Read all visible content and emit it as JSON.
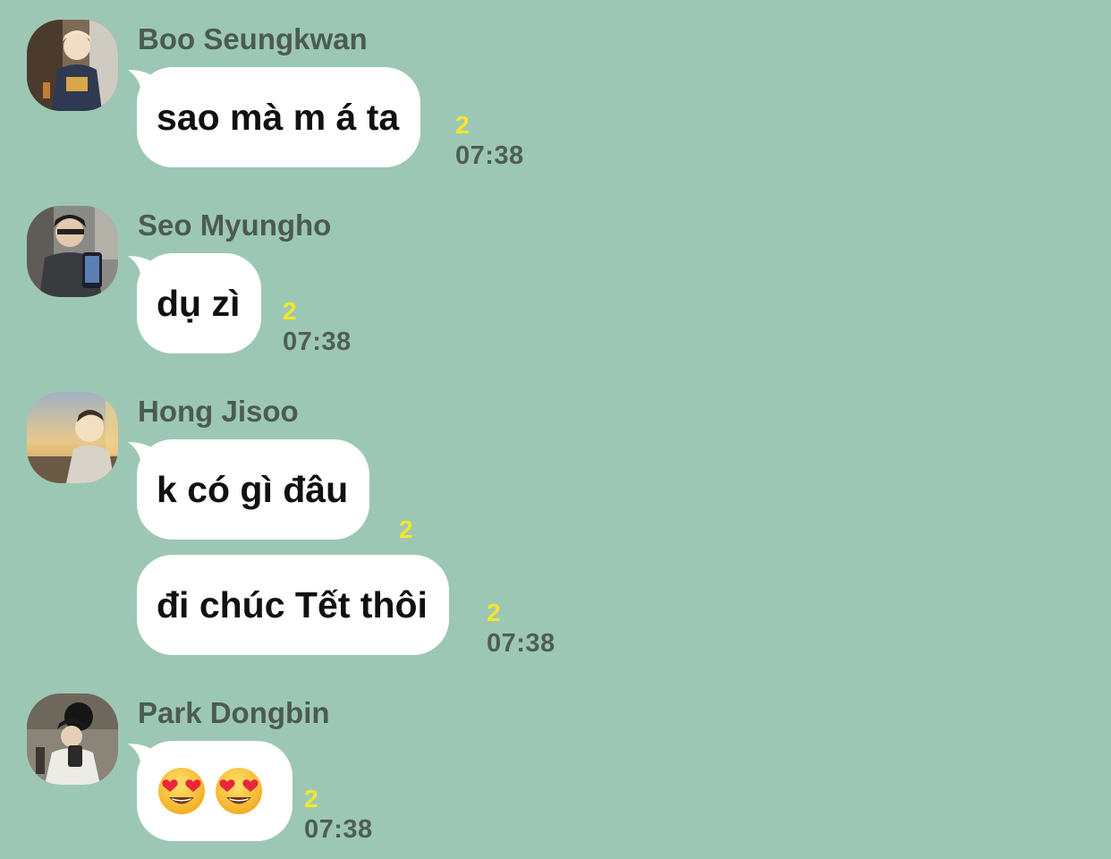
{
  "messages": [
    {
      "sender": "Boo Seungkwan",
      "bubbles": [
        {
          "text": "sao mà m á ta",
          "unread": "2",
          "time": "07:38"
        }
      ]
    },
    {
      "sender": "Seo Myungho",
      "bubbles": [
        {
          "text": "dụ zì",
          "unread": "2",
          "time": "07:38"
        }
      ]
    },
    {
      "sender": "Hong Jisoo",
      "bubbles": [
        {
          "text": "k có gì đâu",
          "unread": "2",
          "time": ""
        },
        {
          "text": "đi chúc Tết thôi",
          "unread": "2",
          "time": "07:38"
        }
      ]
    },
    {
      "sender": "Park Dongbin",
      "bubbles": [
        {
          "emoji": [
            "heart-eyes",
            "heart-eyes"
          ],
          "unread": "2",
          "time": "07:38"
        }
      ]
    }
  ],
  "colors": {
    "background": "#9dc7b5",
    "bubble": "#ffffff",
    "unread": "#f5e62a",
    "sender": "#4c5a55"
  }
}
